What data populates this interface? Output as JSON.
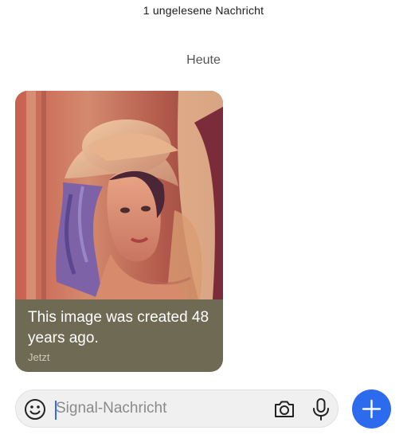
{
  "header": {
    "unread_label": "1 ungelesene Nachricht"
  },
  "conversation": {
    "date_label": "Heute",
    "messages": [
      {
        "attachment_icon": "photo-of-woman-in-hat",
        "caption": "This image was created 48 years ago.",
        "time": "Jetzt",
        "bubble_color": "#6f6a53"
      }
    ]
  },
  "composer": {
    "placeholder": "Signal-Nachricht",
    "value": "",
    "emoji_icon": "emoji-icon",
    "camera_icon": "camera-icon",
    "mic_icon": "microphone-icon",
    "add_icon": "plus-icon"
  },
  "colors": {
    "accent": "#2c6bed",
    "composer_bg": "#f0f0f0"
  }
}
